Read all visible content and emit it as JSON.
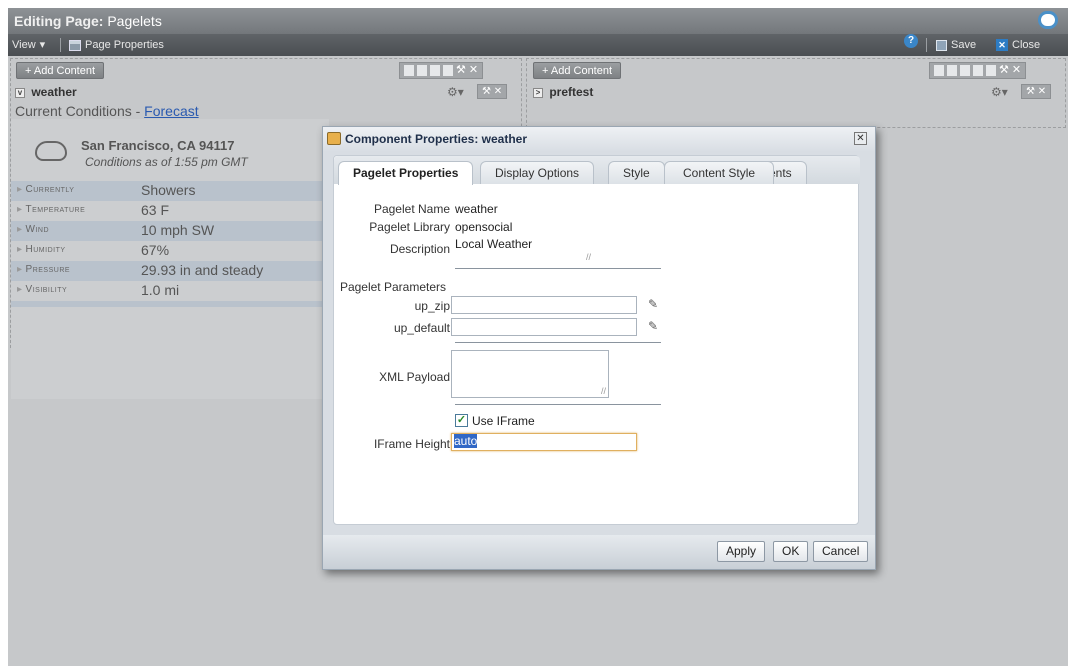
{
  "window": {
    "title_prefix": "Editing Page:",
    "title_page": "Pagelets"
  },
  "toolbar": {
    "view_label": "View",
    "page_properties_label": "Page Properties",
    "save_label": "Save",
    "close_label": "Close"
  },
  "left_column": {
    "add_content_label": "+ Add Content",
    "pagelet_title": "weather",
    "weather": {
      "heading": "Current Conditions - ",
      "forecast_link": "Forecast",
      "location": "San Francisco, CA 94117",
      "conditions_time": "Conditions as of 1:55 pm GMT",
      "rows": [
        {
          "label": "Currently",
          "value": "Showers"
        },
        {
          "label": "Temperature",
          "value": "63 F"
        },
        {
          "label": "Wind",
          "value": "10 mph SW"
        },
        {
          "label": "Humidity",
          "value": "67%"
        },
        {
          "label": "Pressure",
          "value": "29.93 in and steady"
        },
        {
          "label": "Visibility",
          "value": "1.0 mi"
        }
      ]
    }
  },
  "right_column": {
    "add_content_label": "+ Add Content",
    "pagelet_title": "preftest"
  },
  "dialog": {
    "title": "Component Properties: weather",
    "tabs": [
      "Pagelet Properties",
      "Display Options",
      "Style",
      "Content Style",
      "Events"
    ],
    "active_tab": "Pagelet Properties",
    "fields": {
      "pagelet_name_label": "Pagelet Name",
      "pagelet_name": "weather",
      "pagelet_library_label": "Pagelet Library",
      "pagelet_library": "opensocial",
      "description_label": "Description",
      "description": "Local Weather",
      "params_label": "Pagelet Parameters",
      "up_zip_label": "up_zip",
      "up_zip": "",
      "up_default_label": "up_default",
      "up_default": "",
      "xml_payload_label": "XML Payload",
      "use_iframe_label": "Use IFrame",
      "use_iframe_checked": true,
      "iframe_height_label": "IFrame Height",
      "iframe_height": "auto"
    },
    "buttons": {
      "apply": "Apply",
      "ok": "OK",
      "cancel": "Cancel"
    }
  }
}
